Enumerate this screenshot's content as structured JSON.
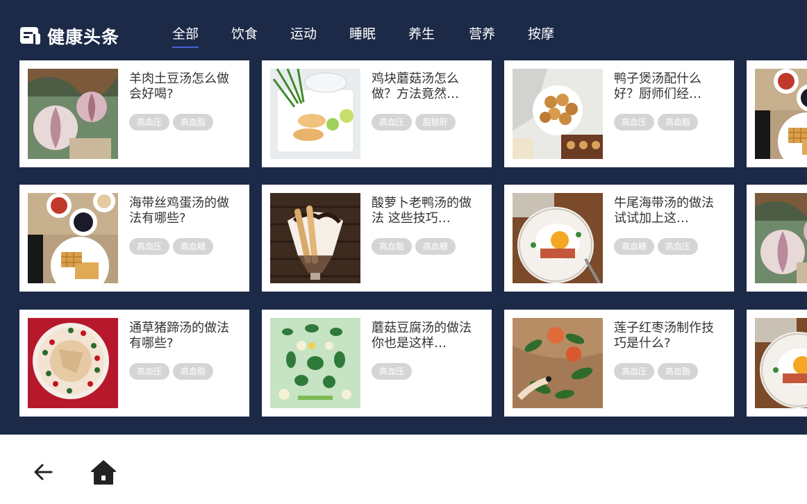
{
  "header": {
    "title": "健康头条",
    "tabs": [
      {
        "label": "全部",
        "active": true
      },
      {
        "label": "饮食",
        "active": false
      },
      {
        "label": "运动",
        "active": false
      },
      {
        "label": "睡眠",
        "active": false
      },
      {
        "label": "养生",
        "active": false
      },
      {
        "label": "营养",
        "active": false
      },
      {
        "label": "按摩",
        "active": false
      }
    ]
  },
  "articles": [
    {
      "title": "羊肉土豆汤怎么做会好喝?",
      "tags": [
        "高血压",
        "高血脂"
      ],
      "image": "garlic-thumbnail"
    },
    {
      "title": "鸡块蘑菇汤怎么做？方法竟然…",
      "tags": [
        "高血压",
        "脂肪肝"
      ],
      "image": "plate-greens-thumbnail"
    },
    {
      "title": "鸭子煲汤配什么好？厨师们经…",
      "tags": [
        "高血压",
        "高血脂"
      ],
      "image": "pastries-thumbnail"
    },
    {
      "title": "",
      "tags": [],
      "image": "waffles-thumbnail"
    },
    {
      "title": "海带丝鸡蛋汤的做法有哪些?",
      "tags": [
        "高血压",
        "高血糖"
      ],
      "image": "waffles-thumbnail"
    },
    {
      "title": "酸萝卜老鸭汤的做法 这些技巧…",
      "tags": [
        "高血脂",
        "高血糖"
      ],
      "image": "ice-cream-thumbnail"
    },
    {
      "title": "牛尾海带汤的做法 试试加上这…",
      "tags": [
        "高血糖",
        "高血压"
      ],
      "image": "fried-egg-thumbnail"
    },
    {
      "title": "",
      "tags": [],
      "image": "garlic-thumbnail"
    },
    {
      "title": "通草猪蹄汤的做法有哪些?",
      "tags": [
        "高血压",
        "高血脂"
      ],
      "image": "dessert-thumbnail"
    },
    {
      "title": "蘑菇豆腐汤的做法 你也是这样…",
      "tags": [
        "高血压"
      ],
      "image": "vegetables-thumbnail"
    },
    {
      "title": "莲子红枣汤制作技巧是什么?",
      "tags": [
        "高血压",
        "高血脂"
      ],
      "image": "apples-thumbnail"
    },
    {
      "title": "",
      "tags": [],
      "image": "fried-egg-thumbnail"
    }
  ],
  "navbar": {
    "back_icon": "back-arrow-icon",
    "home_icon": "home-icon"
  },
  "colors": {
    "background": "#1c2a48",
    "tab_indicator": "#4a63d8",
    "tag_bg": "#d5d5d5"
  }
}
